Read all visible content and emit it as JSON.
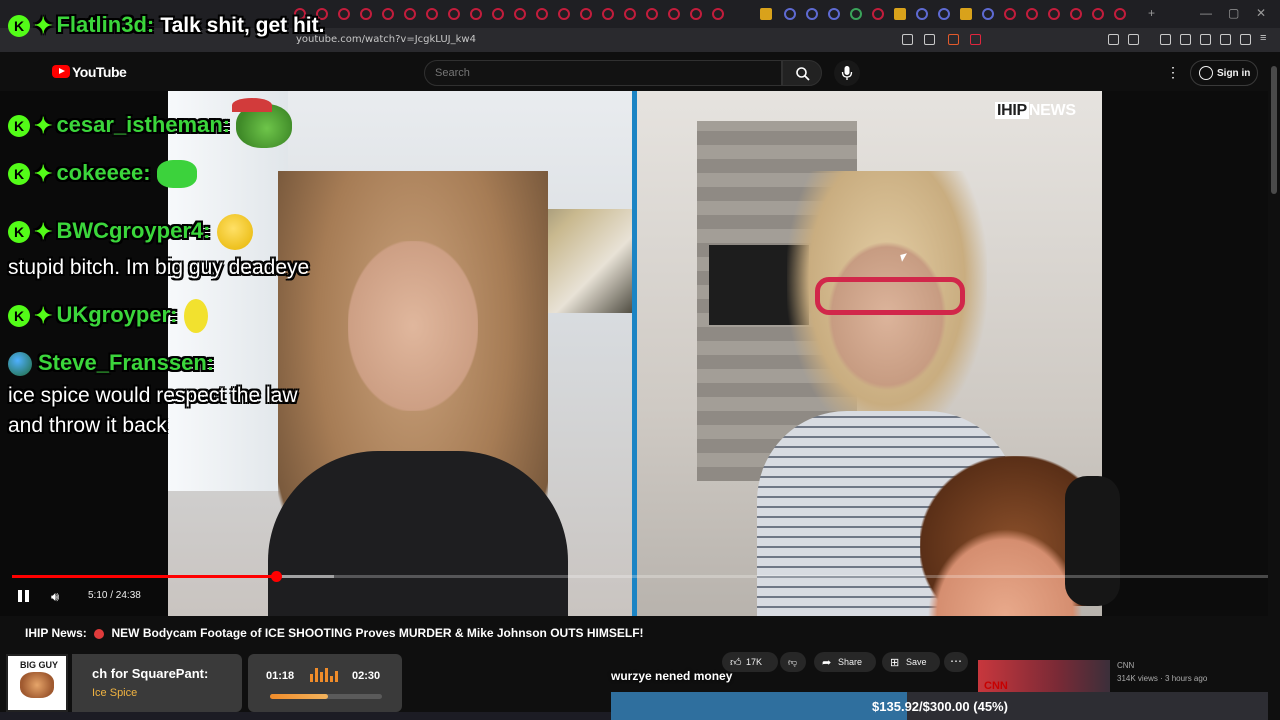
{
  "browser": {
    "url": "youtube.com/watch?v=JcgkLUJ_kw4"
  },
  "header": {
    "logo_text": "YouTube",
    "search_placeholder": "Search",
    "signin_label": "Sign in",
    "icons": [
      "search-icon",
      "mic-icon",
      "more-vert-icon",
      "account-icon"
    ]
  },
  "video": {
    "watermark": "IHIP NEWS",
    "current_time": "5:10",
    "duration": "24:38",
    "time_display": "5:10 / 24:38",
    "progress_fraction": 0.21
  },
  "chat": {
    "top": {
      "user": "Flatlin3d:",
      "message": "Talk shit, get hit."
    },
    "lines": [
      {
        "user": "cesar_istheman:",
        "message": "",
        "emote": "pepe-elf"
      },
      {
        "user": "cokeeee:",
        "message": "",
        "emote": "green-blob"
      },
      {
        "user": "BWCgroyper4:",
        "message": "stupid bitch. Im big guy deadeye",
        "emote": "yellow-face"
      },
      {
        "user": "UKgroyper:",
        "message": "",
        "emote": "lemon"
      },
      {
        "user": "Steve_Franssen:",
        "message_lines": [
          "ice spice would respect the law",
          "and throw it back"
        ]
      }
    ]
  },
  "title": {
    "channel_prefix": "IHIP News:",
    "text": "NEW Bodycam Footage of ICE SHOOTING Proves MURDER & Mike Johnson OUTS HIMSELF!"
  },
  "actions": {
    "like_count": "17K",
    "share_label": "Share",
    "save_label": "Save"
  },
  "related": {
    "thumb_text": "CNN",
    "channel": "CNN",
    "meta": "314K views · 3 hours ago"
  },
  "stream_overlay": {
    "song_art_text": "BIG GUY",
    "song_title": "ch for SquarePant:",
    "song_artist": "Ice Spice",
    "song_current": "01:18",
    "song_total": "02:30",
    "song_progress_fraction": 0.52,
    "subtitle": "wurzye nened money",
    "goal_text": "$135.92/$300.00 (45%)",
    "goal_fraction": 0.45
  },
  "colors": {
    "youtube_red": "#ff0000",
    "chat_username": "#3bd63b",
    "kick_green": "#53fc18",
    "goal_fill": "#2f6f9e"
  }
}
